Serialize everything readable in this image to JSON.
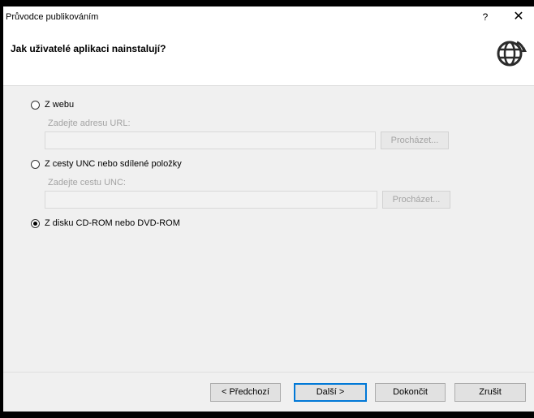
{
  "window": {
    "title": "Průvodce publikováním",
    "help_label": "?",
    "close_label": "✕"
  },
  "header": {
    "heading": "Jak uživatelé aplikaci nainstalují?",
    "icon": "globe-icon"
  },
  "options": [
    {
      "label": "Z webu",
      "selected": false,
      "sublabel": "Zadejte adresu URL:",
      "field_value": "",
      "browse_label": "Procházet..."
    },
    {
      "label": "Z cesty UNC nebo sdílené položky",
      "selected": false,
      "sublabel": "Zadejte cestu UNC:",
      "field_value": "",
      "browse_label": "Procházet..."
    },
    {
      "label": "Z disku CD-ROM nebo DVD-ROM",
      "selected": true
    }
  ],
  "footer": {
    "back_label": "< Předchozí",
    "next_label": "Další >",
    "finish_label": "Dokončit",
    "cancel_label": "Zrušit"
  },
  "colors": {
    "dialog_bg": "#f0f0f0",
    "header_bg": "#ffffff",
    "disabled_text": "#a3a3a3",
    "default_button_border": "#0078d7"
  }
}
